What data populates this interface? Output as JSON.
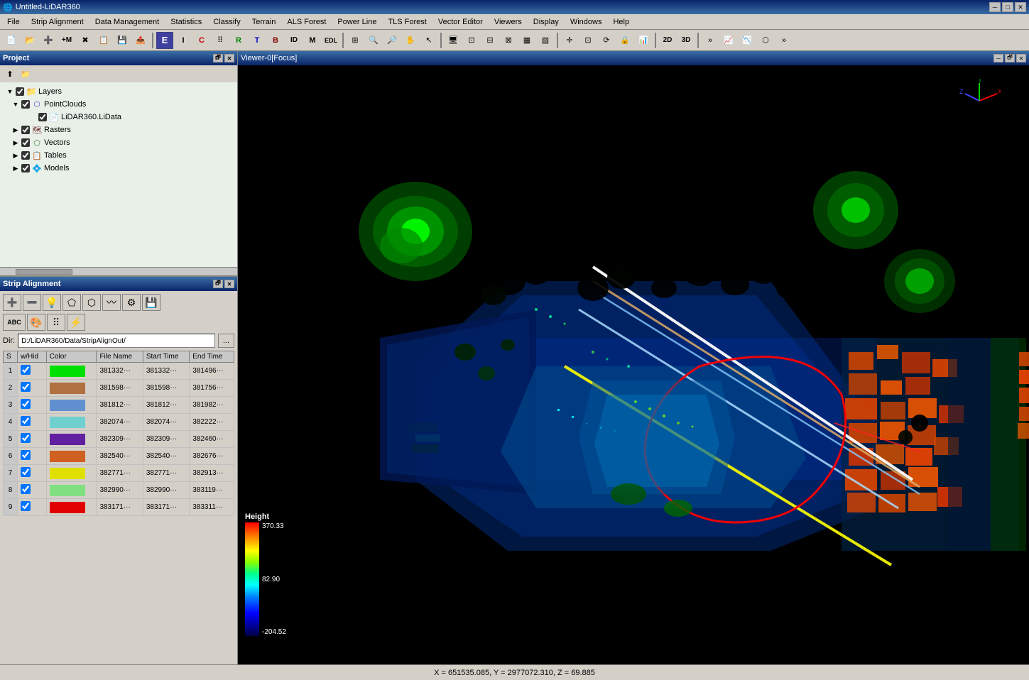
{
  "titlebar": {
    "title": "Untitled-LiDAR360",
    "icon": "🌐",
    "min": "─",
    "max": "□",
    "close": "✕"
  },
  "menubar": {
    "items": [
      "File",
      "Strip Alignment",
      "Data Management",
      "Statistics",
      "Classify",
      "Terrain",
      "ALS Forest",
      "Power Line",
      "TLS Forest",
      "Vector Editor",
      "Viewers",
      "Display",
      "Windows",
      "Help"
    ]
  },
  "project": {
    "title": "Project",
    "tree": {
      "layers": "Layers",
      "pointclouds": "PointClouds",
      "lidata": "LiDAR360.LiData",
      "rasters": "Rasters",
      "vectors": "Vectors",
      "tables": "Tables",
      "models": "Models"
    }
  },
  "strip_alignment": {
    "title": "Strip Alignment",
    "dir_label": "Dir:",
    "dir_value": "D:/LiDAR360/Data/StripAlignOut/",
    "browse_btn": "...",
    "table": {
      "headers": [
        "S",
        "w/Hid",
        "Color",
        "File Name",
        "Start Time",
        "End Time"
      ],
      "rows": [
        {
          "num": "1",
          "checked": true,
          "color": "#00e000",
          "filename": "381332···",
          "start": "381332···",
          "end": "381496···"
        },
        {
          "num": "2",
          "checked": true,
          "color": "#b07040",
          "filename": "381598···",
          "start": "381598···",
          "end": "381756···"
        },
        {
          "num": "3",
          "checked": true,
          "color": "#6090d0",
          "filename": "381812···",
          "start": "381812···",
          "end": "381982···"
        },
        {
          "num": "4",
          "checked": true,
          "color": "#70d0d0",
          "filename": "382074···",
          "start": "382074···",
          "end": "382222···"
        },
        {
          "num": "5",
          "checked": true,
          "color": "#6020a0",
          "filename": "382309···",
          "start": "382309···",
          "end": "382460···"
        },
        {
          "num": "6",
          "checked": true,
          "color": "#d06020",
          "filename": "382540···",
          "start": "382540···",
          "end": "382676···"
        },
        {
          "num": "7",
          "checked": true,
          "color": "#e0e000",
          "filename": "382771···",
          "start": "382771···",
          "end": "382913···"
        },
        {
          "num": "8",
          "checked": true,
          "color": "#80e080",
          "filename": "382990···",
          "start": "382990···",
          "end": "383119···"
        },
        {
          "num": "9",
          "checked": true,
          "color": "#e00000",
          "filename": "383171···",
          "start": "383171···",
          "end": "383311···"
        }
      ]
    }
  },
  "viewer": {
    "title": "Viewer-0[Focus]"
  },
  "legend": {
    "label": "Height",
    "max_val": "370.33",
    "mid_val": "82.90",
    "min_val": "-204.52"
  },
  "statusbar": {
    "coords": "X = 651535.085, Y = 2977072.310, Z = 69.885"
  },
  "toolbar": {
    "buttons_2d3d": [
      "2D",
      "3D"
    ]
  }
}
